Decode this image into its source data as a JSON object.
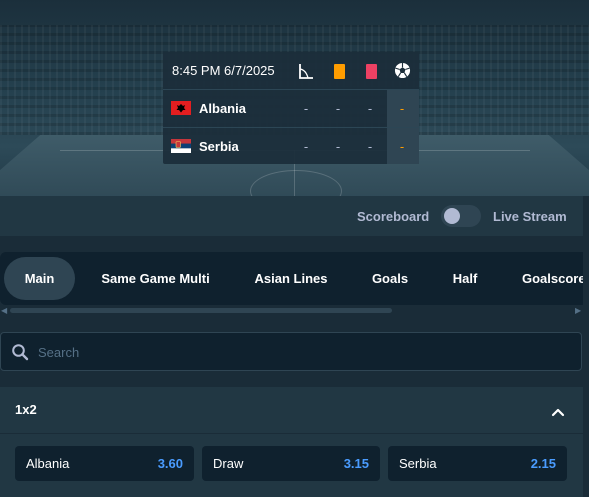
{
  "match": {
    "datetime": "8:45 PM 6/7/2025",
    "home": {
      "name": "Albania",
      "cells": [
        "-",
        "-",
        "-"
      ],
      "goals": "-"
    },
    "away": {
      "name": "Serbia",
      "cells": [
        "-",
        "-",
        "-"
      ],
      "goals": "-"
    },
    "icons": [
      "corner-flag-icon",
      "yellow-card-icon",
      "red-card-icon",
      "soccer-ball-icon"
    ],
    "colors": {
      "yellow_card": "#ff9d00",
      "red_card": "#ed4163",
      "goal_dash": "#ff9d00"
    }
  },
  "toggle": {
    "scoreboard_label": "Scoreboard",
    "live_stream_label": "Live Stream",
    "scoreboard_on": false
  },
  "tabs": [
    {
      "label": "Main",
      "active": true
    },
    {
      "label": "Same Game Multi",
      "active": false
    },
    {
      "label": "Asian Lines",
      "active": false
    },
    {
      "label": "Goals",
      "active": false
    },
    {
      "label": "Half",
      "active": false
    },
    {
      "label": "Goalscore",
      "active": false
    }
  ],
  "search": {
    "placeholder": "Search",
    "value": ""
  },
  "market": {
    "title": "1x2",
    "outcomes": [
      {
        "label": "Albania",
        "price": "3.60"
      },
      {
        "label": "Draw",
        "price": "3.15"
      },
      {
        "label": "Serbia",
        "price": "2.15"
      }
    ]
  },
  "theme": {
    "accent_price": "#4a9cff",
    "bg": "#1a2c38",
    "panel": "#213743",
    "dark": "#0f212e"
  }
}
